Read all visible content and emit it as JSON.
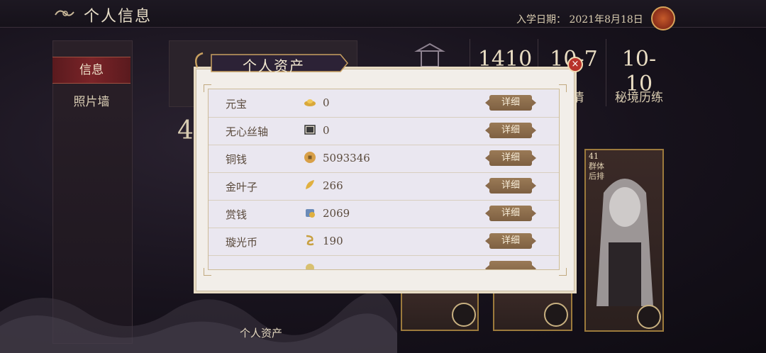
{
  "header": {
    "title": "个人信息",
    "enroll_date": "入学日期：  2021年8月18日"
  },
  "nav": {
    "items": [
      {
        "label": "信息",
        "active": true
      },
      {
        "label": "照片墙",
        "active": false
      }
    ]
  },
  "background": {
    "stats": [
      {
        "value": "1410",
        "label": ""
      },
      {
        "value": "10-7",
        "label": "情"
      },
      {
        "value": "10-10",
        "label": "秘境历练"
      }
    ],
    "big_number": "4",
    "card_badge": "41",
    "card_tags": [
      "群体",
      "后排"
    ],
    "bottom_label": "个人资产"
  },
  "modal": {
    "title": "个人资产",
    "close_label": "×",
    "detail_label": "详细",
    "rows": [
      {
        "name": "元宝",
        "value": "0",
        "icon": "gold-ingot-icon"
      },
      {
        "name": "无心丝轴",
        "value": "0",
        "icon": "silk-scroll-icon"
      },
      {
        "name": "铜钱",
        "value": "5093346",
        "icon": "copper-coin-icon"
      },
      {
        "name": "金叶子",
        "value": "266",
        "icon": "gold-leaf-icon"
      },
      {
        "name": "赏钱",
        "value": "2069",
        "icon": "reward-money-icon"
      },
      {
        "name": "璇光币",
        "value": "190",
        "icon": "xuanguang-coin-icon"
      }
    ]
  },
  "colors": {
    "accent_red": "#7a2428",
    "gold": "#9c7a3c",
    "detail_button": "#8a6b4c"
  }
}
